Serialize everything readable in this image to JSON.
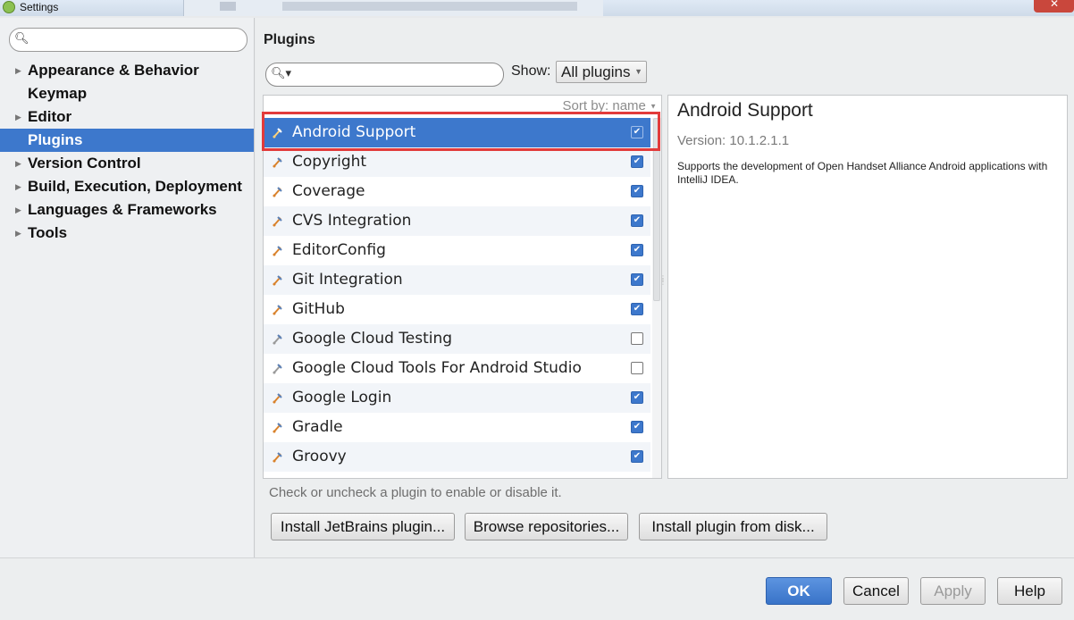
{
  "window": {
    "title": "Settings"
  },
  "sidebar": {
    "search_placeholder": "",
    "items": [
      {
        "label": "Appearance & Behavior",
        "expandable": true
      },
      {
        "label": "Keymap",
        "expandable": false
      },
      {
        "label": "Editor",
        "expandable": true
      },
      {
        "label": "Plugins",
        "expandable": false,
        "active": true
      },
      {
        "label": "Version Control",
        "expandable": true
      },
      {
        "label": "Build, Execution, Deployment",
        "expandable": true
      },
      {
        "label": "Languages & Frameworks",
        "expandable": true
      },
      {
        "label": "Tools",
        "expandable": true
      }
    ]
  },
  "main": {
    "heading": "Plugins",
    "search_placeholder": "",
    "show_label": "Show:",
    "show_value": "All plugins",
    "sort_label": "Sort by: name",
    "plugins": [
      {
        "name": "Android Support",
        "checked": true,
        "selected": true
      },
      {
        "name": "Copyright",
        "checked": true
      },
      {
        "name": "Coverage",
        "checked": true
      },
      {
        "name": "CVS Integration",
        "checked": true
      },
      {
        "name": "EditorConfig",
        "checked": true
      },
      {
        "name": "Git Integration",
        "checked": true
      },
      {
        "name": "GitHub",
        "checked": true
      },
      {
        "name": "Google Cloud Testing",
        "checked": false
      },
      {
        "name": "Google Cloud Tools For Android Studio",
        "checked": false
      },
      {
        "name": "Google Login",
        "checked": true
      },
      {
        "name": "Gradle",
        "checked": true
      },
      {
        "name": "Groovy",
        "checked": true
      }
    ],
    "detail": {
      "name": "Android Support",
      "version": "Version: 10.1.2.1.1",
      "description": "Supports the development of Open Handset Alliance Android applications with IntelliJ IDEA."
    },
    "hint": "Check or uncheck a plugin to enable or disable it.",
    "buttons": {
      "install_jetbrains": "Install JetBrains plugin...",
      "browse_repositories": "Browse repositories...",
      "install_from_disk": "Install plugin from disk..."
    }
  },
  "footer": {
    "ok": "OK",
    "cancel": "Cancel",
    "apply": "Apply",
    "help": "Help"
  },
  "colors": {
    "selection": "#3d78cc",
    "highlight_outline": "#e23b3b"
  }
}
